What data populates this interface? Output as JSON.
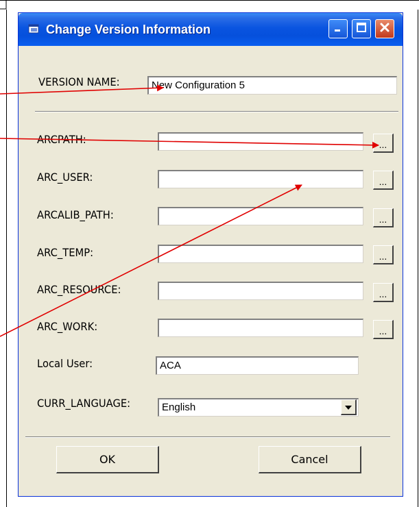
{
  "window": {
    "title": "Change Version Information",
    "accent": "#0a54e0",
    "background": "#ece9d8"
  },
  "titlebar_buttons": {
    "minimize_icon": "minimize-icon",
    "maximize_icon": "maximize-icon",
    "close_icon": "close-icon"
  },
  "version_name": {
    "label": "VERSION NAME:",
    "value": "New Configuration 5"
  },
  "paths": [
    {
      "label": "ARCPATH:",
      "value": "",
      "browse": "..."
    },
    {
      "label": "ARC_USER:",
      "value": "",
      "browse": "..."
    },
    {
      "label": "ARCALIB_PATH:",
      "value": "",
      "browse": "..."
    },
    {
      "label": "ARC_TEMP:",
      "value": "",
      "browse": "..."
    },
    {
      "label": "ARC_RESOURCE:",
      "value": "",
      "browse": "..."
    },
    {
      "label": "ARC_WORK:",
      "value": "",
      "browse": "..."
    }
  ],
  "local_user": {
    "label": "Local User:",
    "value": "ACA"
  },
  "curr_language": {
    "label": "CURR_LANGUAGE:",
    "selected": "English"
  },
  "buttons": {
    "ok": "OK",
    "cancel": "Cancel"
  },
  "annotation_color": "#e00000"
}
